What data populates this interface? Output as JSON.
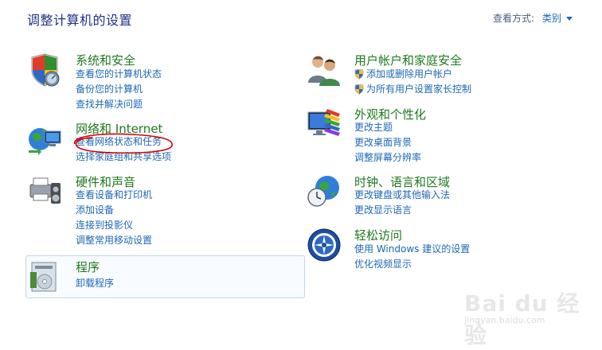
{
  "header": {
    "title": "调整计算机的设置",
    "view_by_label": "查看方式:",
    "view_by_value": "类别"
  },
  "categories": {
    "system": {
      "title": "系统和安全",
      "links": [
        "查看您的计算机状态",
        "备份您的计算机",
        "查找并解决问题"
      ]
    },
    "network": {
      "title": "网络和 Internet",
      "links": [
        "查看网络状态和任务",
        "选择家庭组和共享选项"
      ]
    },
    "hardware": {
      "title": "硬件和声音",
      "links": [
        "查看设备和打印机",
        "添加设备",
        "连接到投影仪",
        "调整常用移动设置"
      ]
    },
    "programs": {
      "title": "程序",
      "links": [
        "卸载程序"
      ]
    },
    "users": {
      "title": "用户帐户和家庭安全",
      "links": [
        "添加或删除用户帐户",
        "为所有用户设置家长控制"
      ]
    },
    "appearance": {
      "title": "外观和个性化",
      "links": [
        "更改主题",
        "更改桌面背景",
        "调整屏幕分辨率"
      ]
    },
    "clock": {
      "title": "时钟、语言和区域",
      "links": [
        "更改键盘或其他输入法",
        "更改显示语言"
      ]
    },
    "ease": {
      "title": "轻松访问",
      "links": [
        "使用 Windows 建议的设置",
        "优化视频显示"
      ]
    }
  },
  "watermark": {
    "brand": "Bai du 经验",
    "url": "jingyan.baidu.com"
  },
  "colors": {
    "title_green": "#1e7a1e",
    "link_blue": "#1e68b4",
    "annotation_red": "#d40000"
  }
}
